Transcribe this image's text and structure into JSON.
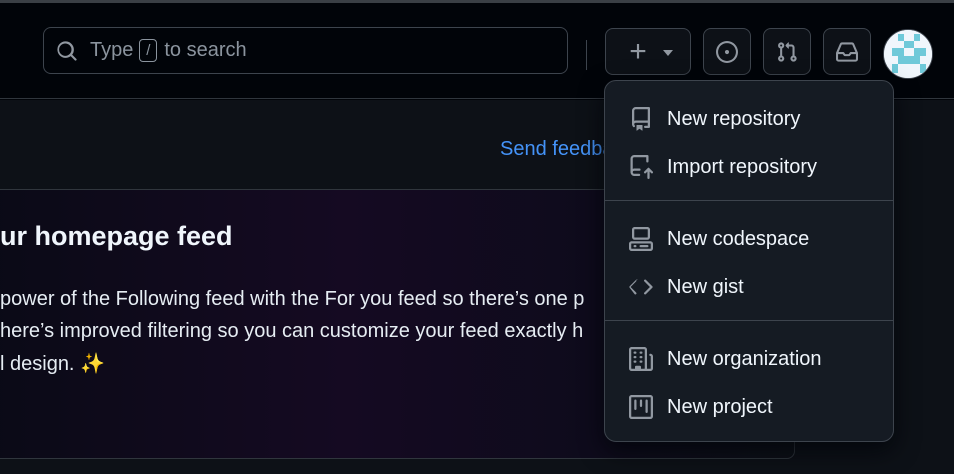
{
  "header": {
    "search": {
      "prefix": "Type",
      "key": "/",
      "suffix": "to search"
    },
    "create_icon": "plus-icon",
    "issues_icon": "issue-opened-icon",
    "pull_requests_icon": "git-pull-request-icon",
    "inbox_icon": "inbox-icon"
  },
  "main": {
    "feedback_link": "Send feedback",
    "feed": {
      "title": "ur homepage feed",
      "lines": [
        "power of the Following feed with the For you feed so there’s one p",
        "here’s improved filtering so you can customize your feed exactly h",
        "l design. ✨"
      ]
    }
  },
  "create_menu": {
    "groups": [
      [
        {
          "label": "New repository",
          "icon": "repo-icon"
        },
        {
          "label": "Import repository",
          "icon": "repo-push-icon"
        }
      ],
      [
        {
          "label": "New codespace",
          "icon": "codespaces-icon"
        },
        {
          "label": "New gist",
          "icon": "code-icon"
        }
      ],
      [
        {
          "label": "New organization",
          "icon": "organization-icon"
        },
        {
          "label": "New project",
          "icon": "project-icon"
        }
      ]
    ]
  },
  "colors": {
    "accent_link": "#4493f8",
    "background": "#010409",
    "menu_bg": "#151b23",
    "border": "#3d444d"
  }
}
